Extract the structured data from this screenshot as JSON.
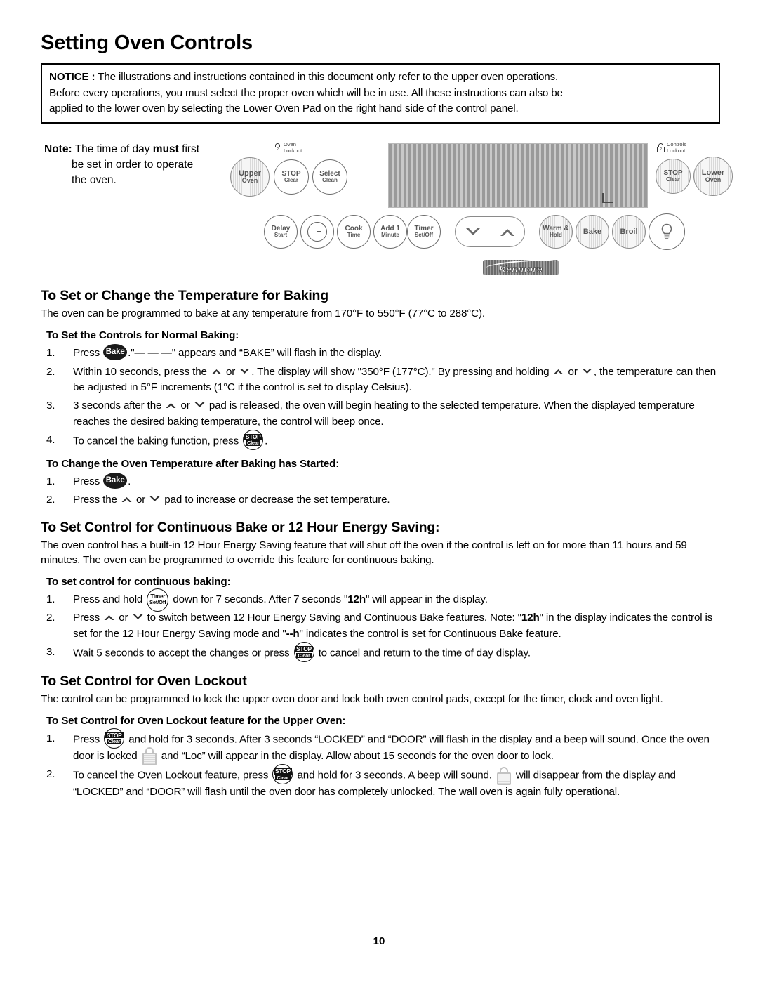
{
  "document": {
    "title": "Setting Oven Controls",
    "page_number": "10"
  },
  "notice": {
    "label": "NOTICE :",
    "line1_rest": " The illustrations and instructions contained in this document only refer to the upper oven operations.",
    "line2": "Before every operations, you must select the proper oven which will be in use. All these instructions can also be",
    "line3": "applied to the lower oven by selecting the Lower Oven Pad on the right hand side of the control panel."
  },
  "note": {
    "label": "Note:",
    "part1": " The time of day ",
    "strong": "must",
    "part2": " first",
    "line2": "be set in order to operate",
    "line3": "the oven."
  },
  "control_panel": {
    "brand": "Kenmore",
    "upper_oven": {
      "line1": "Upper",
      "line2": "Oven"
    },
    "stop_left": {
      "line1": "STOP",
      "line2": "Clear"
    },
    "select_clean": {
      "line1": "Select",
      "line2": "Clean"
    },
    "oven_lockout_label": {
      "line1": "Oven",
      "line2": "Lockout"
    },
    "controls_lockout_label": {
      "line1": "Controls",
      "line2": "Lockout"
    },
    "stop_right": {
      "line1": "STOP",
      "line2": "Clear"
    },
    "lower_oven": {
      "line1": "Lower",
      "line2": "Oven"
    },
    "delay_start": {
      "line1": "Delay",
      "line2": "Start"
    },
    "clock": {
      "line1": "",
      "line2": ""
    },
    "cook_time": {
      "line1": "Cook",
      "line2": "Time"
    },
    "add_1_minute": {
      "line1": "Add 1",
      "line2": "Minute"
    },
    "timer_set_off": {
      "line1": "Timer",
      "line2": "Set/Off"
    },
    "warm_hold": {
      "line1": "Warm &",
      "line2": "Hold"
    },
    "bake": {
      "line1": "Bake",
      "line2": ""
    },
    "broil": {
      "line1": "Broil",
      "line2": ""
    },
    "oven_light": {
      "line1": "",
      "line2": ""
    }
  },
  "sections": {
    "baking": {
      "heading": "To Set or Change the Temperature for Baking",
      "intro": "The oven can be programmed to bake at any temperature from 170°F to 550°F (77°C to 288°C).",
      "sub_normal": "To Set the Controls for Normal Baking:",
      "step1_a": "Press ",
      "step1_icon": "Bake",
      "step1_b": ".\"— — —\" appears and “BAKE” will flash in the display.",
      "step2_a": "Within 10 seconds, press the ",
      "step2_b": " or ",
      "step2_c": ".  The display will show \"350°F (177°C).\" By pressing and holding ",
      "step2_d": " or ",
      "step2_e": ", the temperature can then be adjusted in 5°F increments (1°C if the control is set to display Celsius).",
      "step3_a": "3 seconds after the ",
      "step3_b": " or ",
      "step3_c": " pad is released, the oven will begin heating to the selected temperature. When the displayed temperature reaches the desired baking temperature, the control will beep once.",
      "step4_a": "To cancel the baking function, press ",
      "step4_b": ".",
      "sub_change": "To Change the Oven Temperature after Baking has Started:",
      "change_step1_a": "Press ",
      "change_step1_icon": "Bake",
      "change_step1_b": ".",
      "change_step2_a": "Press the ",
      "change_step2_b": " or ",
      "change_step2_c": " pad to increase or decrease the set temperature."
    },
    "continuous": {
      "heading": "To Set Control for Continuous Bake or 12 Hour Energy Saving:",
      "intro": "The oven control has a built-in 12 Hour Energy Saving feature that will shut off the oven if the control is left on for more than 11 hours and 59 minutes. The oven can be programmed to override this feature for continuous baking.",
      "sub": "To set control for continuous baking:",
      "step1_a": "Press and hold ",
      "step1_b": " down for 7 seconds. After 7 seconds \"",
      "step1_bold": "12h",
      "step1_c": "\" will appear in the display.",
      "step2_a": "Press ",
      "step2_b": " or ",
      "step2_c": " to switch between 12 Hour Energy Saving and Continuous Bake features. Note: \"",
      "step2_bold1": "12h",
      "step2_d": "\" in the display indicates the control is set for the 12 Hour Energy Saving mode and \"",
      "step2_bold2": "--h",
      "step2_e": "\" indicates the control is set for Continuous Bake feature.",
      "step3_a": "Wait 5 seconds to accept the changes or press ",
      "step3_b": " to cancel and return to the time of day display."
    },
    "lockout": {
      "heading": "To Set Control for Oven Lockout",
      "intro": "The control can be programmed to lock the upper oven door and lock both oven control pads, except for the timer, clock and oven light.",
      "sub": "To Set Control for Oven Lockout feature for the Upper Oven:",
      "step1_a": "Press ",
      "step1_b": " and hold for 3 seconds. After 3 seconds “LOCKED” and “DOOR” will flash in the display and a beep will sound. Once the oven door is locked ",
      "step1_c": " and “Loc” will appear in the display. Allow about 15 seconds for the oven door to lock.",
      "step2_a": "To cancel the Oven Lockout feature, press ",
      "step2_b": " and hold for 3 seconds. A beep will sound. ",
      "step2_c": " will disappear from the display and “LOCKED” and “DOOR” will flash until the oven door has completely unlocked. The wall oven is again fully operational."
    }
  }
}
